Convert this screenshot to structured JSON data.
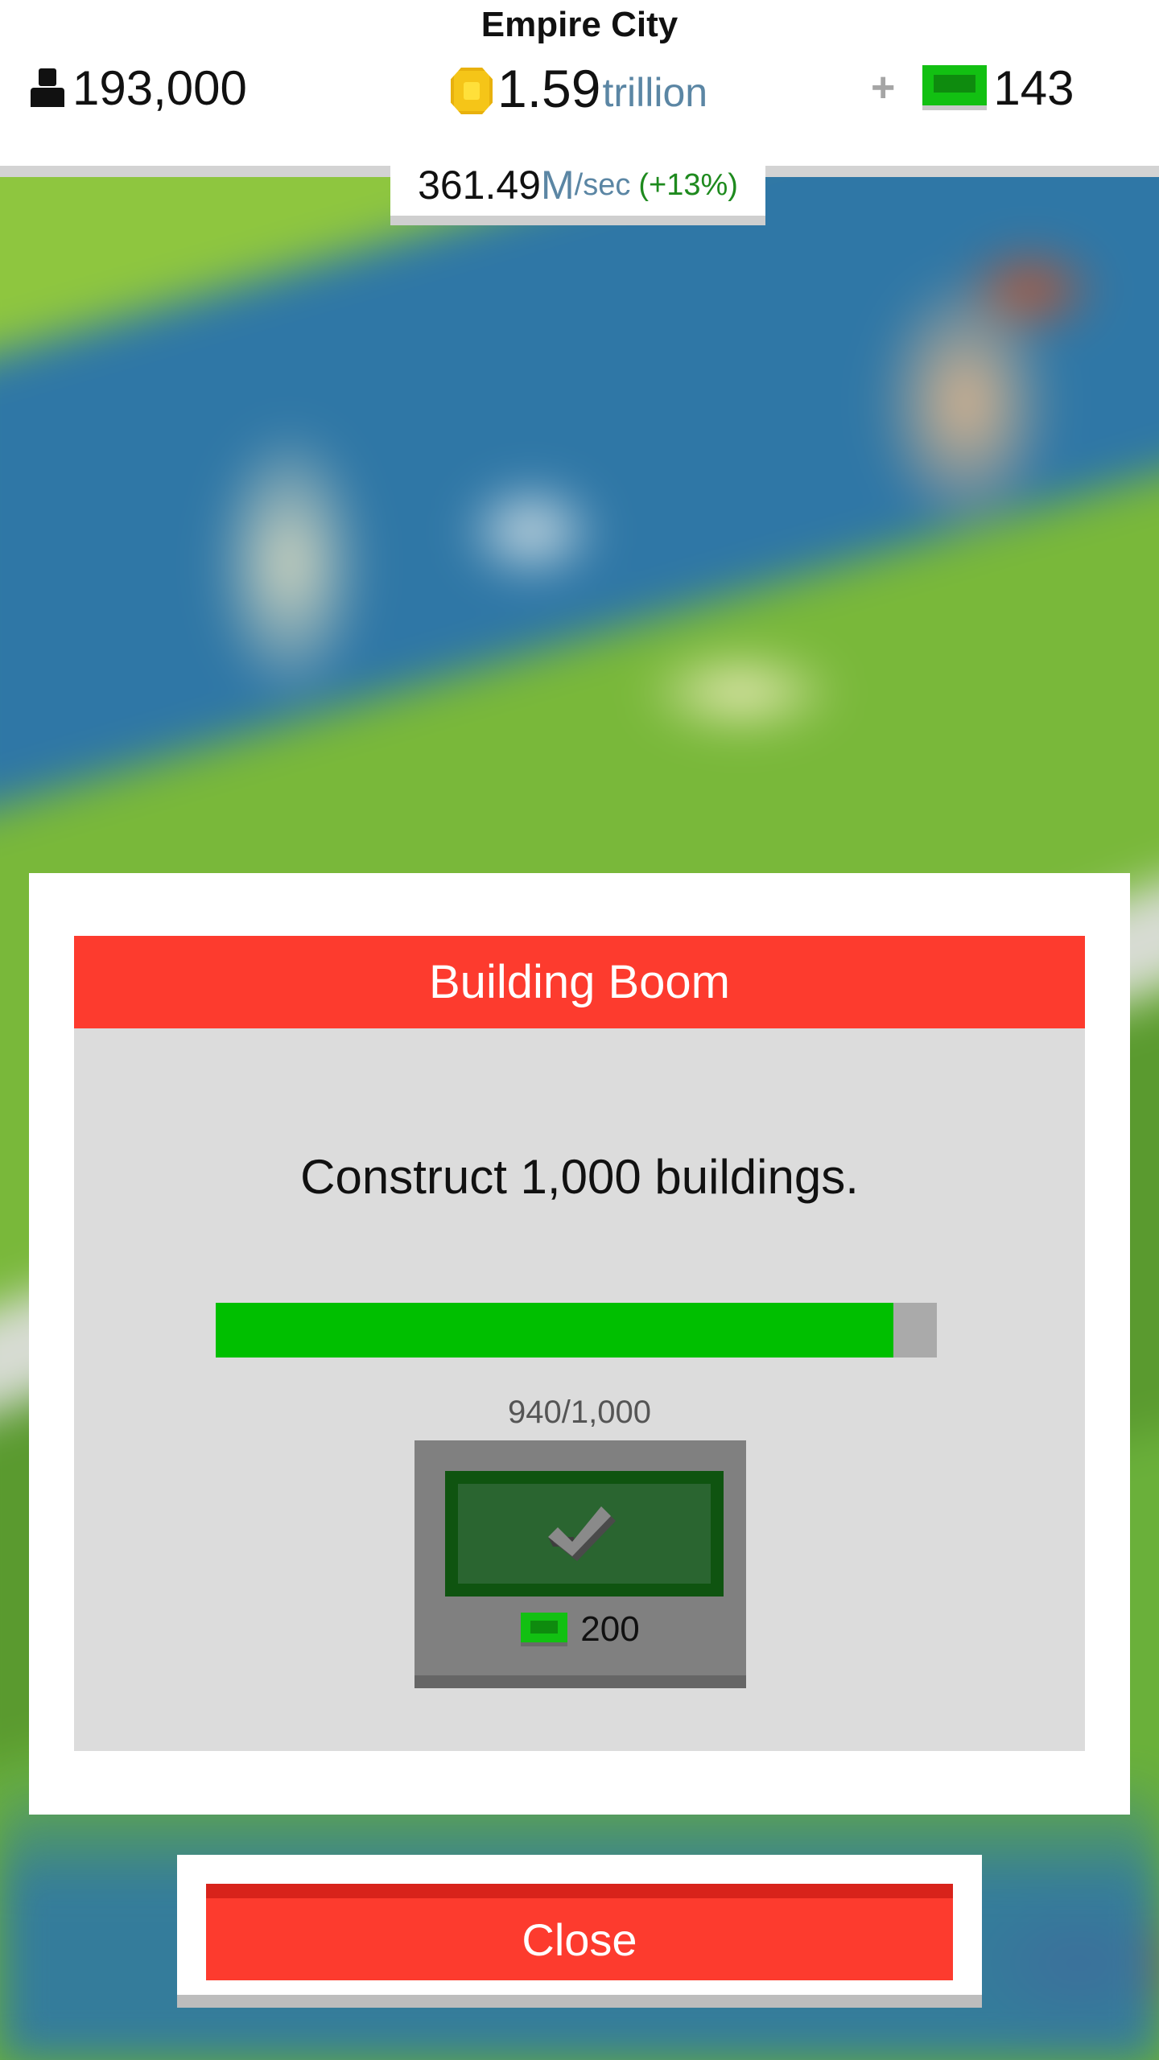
{
  "hud": {
    "city_name": "Empire City",
    "population": "193,000",
    "money_value": "1.59",
    "money_unit": "trillion",
    "plus_label": "+",
    "cash_value": "143",
    "rate_value": "361.49",
    "rate_unit": "M",
    "rate_per": "/sec",
    "rate_percent": "(+13%)"
  },
  "dialog": {
    "title": "Building Boom",
    "description": "Construct 1,000 buildings.",
    "progress_text": "940/1,000",
    "progress_fraction": 0.94,
    "reward_value": "200"
  },
  "close_label": "Close",
  "icons": {
    "population": "person-icon",
    "money": "coin-icon",
    "cash": "cash-bill-icon",
    "claim": "checkmark-icon"
  },
  "colors": {
    "header_red": "#fd3b2e",
    "progress_green": "#00bf00",
    "cash_green": "#12c012"
  }
}
